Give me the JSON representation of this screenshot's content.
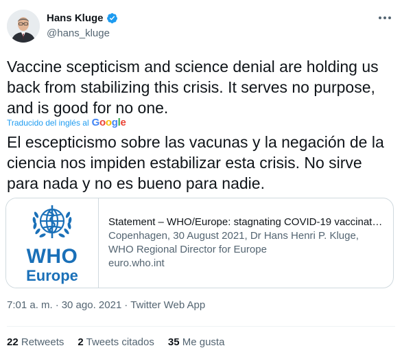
{
  "author": {
    "name": "Hans Kluge",
    "handle": "@hans_kluge",
    "verified": true
  },
  "tweet": {
    "text": "Vaccine scepticism and science denial are holding us back from stabilizing this crisis. It serves no purpose, and is good for no one.",
    "translated_by_label": "Traducido del inglés al",
    "translator_brand": [
      "G",
      "o",
      "o",
      "g",
      "l",
      "e"
    ],
    "translated_text": "El escepticismo sobre las vacunas y la negación de la ciencia nos impiden estabilizar esta crisis. No sirve para nada y no es bueno para nadie."
  },
  "card": {
    "logo_line1": "WHO",
    "logo_line2": "Europe",
    "title": "Statement – WHO/Europe: stagnating COVID-19 vaccinatio…",
    "description": "Copenhagen, 30 August 2021, Dr Hans Henri P. Kluge, WHO Regional Director for Europe",
    "domain": "euro.who.int",
    "logo_color": "#1a70b8"
  },
  "meta": {
    "time": "7:01 a. m.",
    "separator": "·",
    "date": "30 ago. 2021",
    "source": "Twitter Web App"
  },
  "stats": {
    "retweets_count": "22",
    "retweets_label": "Retweets",
    "quotes_count": "2",
    "quotes_label": "Tweets citados",
    "likes_count": "35",
    "likes_label": "Me gusta"
  },
  "colors": {
    "accent": "#1d9bf0",
    "text_primary": "#0f1419",
    "text_secondary": "#536471"
  }
}
